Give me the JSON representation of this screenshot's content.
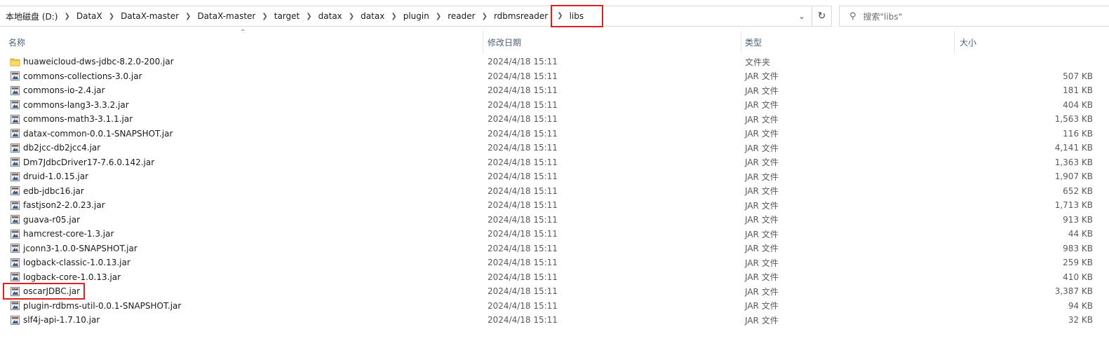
{
  "breadcrumb": [
    {
      "label": "本地磁盘 (D:)"
    },
    {
      "label": "DataX"
    },
    {
      "label": "DataX-master"
    },
    {
      "label": "DataX-master"
    },
    {
      "label": "target"
    },
    {
      "label": "datax"
    },
    {
      "label": "datax"
    },
    {
      "label": "plugin"
    },
    {
      "label": "reader"
    },
    {
      "label": "rdbmsreader"
    },
    {
      "label": "libs"
    }
  ],
  "search": {
    "placeholder": "搜索\"libs\""
  },
  "icons": {
    "dropdown": "chevron-down-icon",
    "refresh": "refresh-icon",
    "search": "search-icon",
    "folder": "folder-icon",
    "jar": "jar-file-icon"
  },
  "columns": {
    "name": "名称",
    "date": "修改日期",
    "type": "类型",
    "size": "大小"
  },
  "files": [
    {
      "name": "huaweicloud-dws-jdbc-8.2.0-200.jar",
      "date": "2024/4/18 15:11",
      "type": "文件夹",
      "size": "",
      "kind": "folder"
    },
    {
      "name": "commons-collections-3.0.jar",
      "date": "2024/4/18 15:11",
      "type": "JAR 文件",
      "size": "507 KB",
      "kind": "jar"
    },
    {
      "name": "commons-io-2.4.jar",
      "date": "2024/4/18 15:11",
      "type": "JAR 文件",
      "size": "181 KB",
      "kind": "jar"
    },
    {
      "name": "commons-lang3-3.3.2.jar",
      "date": "2024/4/18 15:11",
      "type": "JAR 文件",
      "size": "404 KB",
      "kind": "jar"
    },
    {
      "name": "commons-math3-3.1.1.jar",
      "date": "2024/4/18 15:11",
      "type": "JAR 文件",
      "size": "1,563 KB",
      "kind": "jar"
    },
    {
      "name": "datax-common-0.0.1-SNAPSHOT.jar",
      "date": "2024/4/18 15:11",
      "type": "JAR 文件",
      "size": "116 KB",
      "kind": "jar"
    },
    {
      "name": "db2jcc-db2jcc4.jar",
      "date": "2024/4/18 15:11",
      "type": "JAR 文件",
      "size": "4,141 KB",
      "kind": "jar"
    },
    {
      "name": "Dm7JdbcDriver17-7.6.0.142.jar",
      "date": "2024/4/18 15:11",
      "type": "JAR 文件",
      "size": "1,363 KB",
      "kind": "jar"
    },
    {
      "name": "druid-1.0.15.jar",
      "date": "2024/4/18 15:11",
      "type": "JAR 文件",
      "size": "1,907 KB",
      "kind": "jar"
    },
    {
      "name": "edb-jdbc16.jar",
      "date": "2024/4/18 15:11",
      "type": "JAR 文件",
      "size": "652 KB",
      "kind": "jar"
    },
    {
      "name": "fastjson2-2.0.23.jar",
      "date": "2024/4/18 15:11",
      "type": "JAR 文件",
      "size": "1,713 KB",
      "kind": "jar"
    },
    {
      "name": "guava-r05.jar",
      "date": "2024/4/18 15:11",
      "type": "JAR 文件",
      "size": "913 KB",
      "kind": "jar"
    },
    {
      "name": "hamcrest-core-1.3.jar",
      "date": "2024/4/18 15:11",
      "type": "JAR 文件",
      "size": "44 KB",
      "kind": "jar"
    },
    {
      "name": "jconn3-1.0.0-SNAPSHOT.jar",
      "date": "2024/4/18 15:11",
      "type": "JAR 文件",
      "size": "983 KB",
      "kind": "jar"
    },
    {
      "name": "logback-classic-1.0.13.jar",
      "date": "2024/4/18 15:11",
      "type": "JAR 文件",
      "size": "259 KB",
      "kind": "jar"
    },
    {
      "name": "logback-core-1.0.13.jar",
      "date": "2024/4/18 15:11",
      "type": "JAR 文件",
      "size": "410 KB",
      "kind": "jar"
    },
    {
      "name": "oscarJDBC.jar",
      "date": "2024/4/18 15:11",
      "type": "JAR 文件",
      "size": "3,387 KB",
      "kind": "jar"
    },
    {
      "name": "plugin-rdbms-util-0.0.1-SNAPSHOT.jar",
      "date": "2024/4/18 15:11",
      "type": "JAR 文件",
      "size": "94 KB",
      "kind": "jar"
    },
    {
      "name": "slf4j-api-1.7.10.jar",
      "date": "2024/4/18 15:11",
      "type": "JAR 文件",
      "size": "32 KB",
      "kind": "jar"
    }
  ],
  "colors": {
    "highlight": "#e02020",
    "header_text": "#4c607a",
    "folder": "#f5c842"
  }
}
